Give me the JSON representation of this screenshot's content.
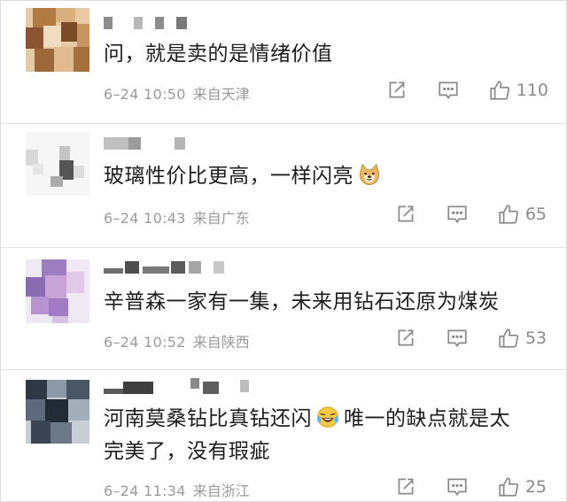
{
  "comments": [
    {
      "text": "问，就是卖的是情绪价值",
      "time": "6–24 10:50",
      "location": "来自天津",
      "likes": "110"
    },
    {
      "text": "玻璃性价比更高，一样闪亮",
      "time": "6–24 10:43",
      "location": "来自广东",
      "likes": "65",
      "emoji": "doge-emoji"
    },
    {
      "text": "辛普森一家有一集，未来用钻石还原为煤炭",
      "time": "6–24 10:52",
      "location": "来自陕西",
      "likes": "53"
    },
    {
      "text_line1": "河南莫桑钻比真钻还闪",
      "text_line1b": "唯一的缺点就是太",
      "text_line2": "完美了，没有瑕疵",
      "time": "6–24 11:34",
      "location": "来自浙江",
      "likes": "25",
      "emoji": "laughing-crying-emoji"
    }
  ],
  "icons": {
    "repost": "repost-icon",
    "comment": "comment-icon",
    "like": "thumbs-up-icon"
  },
  "colors": {
    "text": "#1e1e1e",
    "meta": "#9a9a9a",
    "icon": "#8a8a8a",
    "divider": "#e3e3e3"
  }
}
